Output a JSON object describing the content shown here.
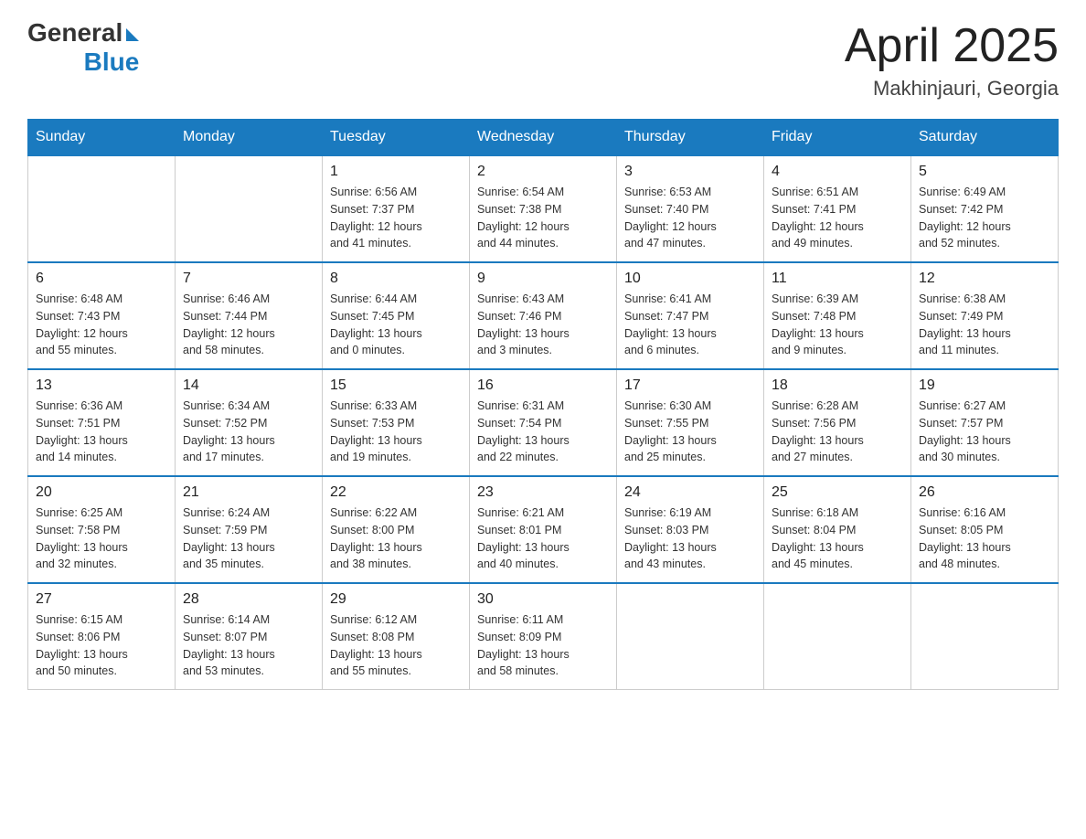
{
  "header": {
    "logo_general": "General",
    "logo_blue": "Blue",
    "month_title": "April 2025",
    "location": "Makhinjauri, Georgia"
  },
  "days_of_week": [
    "Sunday",
    "Monday",
    "Tuesday",
    "Wednesday",
    "Thursday",
    "Friday",
    "Saturday"
  ],
  "weeks": [
    [
      {
        "day": "",
        "info": ""
      },
      {
        "day": "",
        "info": ""
      },
      {
        "day": "1",
        "info": "Sunrise: 6:56 AM\nSunset: 7:37 PM\nDaylight: 12 hours\nand 41 minutes."
      },
      {
        "day": "2",
        "info": "Sunrise: 6:54 AM\nSunset: 7:38 PM\nDaylight: 12 hours\nand 44 minutes."
      },
      {
        "day": "3",
        "info": "Sunrise: 6:53 AM\nSunset: 7:40 PM\nDaylight: 12 hours\nand 47 minutes."
      },
      {
        "day": "4",
        "info": "Sunrise: 6:51 AM\nSunset: 7:41 PM\nDaylight: 12 hours\nand 49 minutes."
      },
      {
        "day": "5",
        "info": "Sunrise: 6:49 AM\nSunset: 7:42 PM\nDaylight: 12 hours\nand 52 minutes."
      }
    ],
    [
      {
        "day": "6",
        "info": "Sunrise: 6:48 AM\nSunset: 7:43 PM\nDaylight: 12 hours\nand 55 minutes."
      },
      {
        "day": "7",
        "info": "Sunrise: 6:46 AM\nSunset: 7:44 PM\nDaylight: 12 hours\nand 58 minutes."
      },
      {
        "day": "8",
        "info": "Sunrise: 6:44 AM\nSunset: 7:45 PM\nDaylight: 13 hours\nand 0 minutes."
      },
      {
        "day": "9",
        "info": "Sunrise: 6:43 AM\nSunset: 7:46 PM\nDaylight: 13 hours\nand 3 minutes."
      },
      {
        "day": "10",
        "info": "Sunrise: 6:41 AM\nSunset: 7:47 PM\nDaylight: 13 hours\nand 6 minutes."
      },
      {
        "day": "11",
        "info": "Sunrise: 6:39 AM\nSunset: 7:48 PM\nDaylight: 13 hours\nand 9 minutes."
      },
      {
        "day": "12",
        "info": "Sunrise: 6:38 AM\nSunset: 7:49 PM\nDaylight: 13 hours\nand 11 minutes."
      }
    ],
    [
      {
        "day": "13",
        "info": "Sunrise: 6:36 AM\nSunset: 7:51 PM\nDaylight: 13 hours\nand 14 minutes."
      },
      {
        "day": "14",
        "info": "Sunrise: 6:34 AM\nSunset: 7:52 PM\nDaylight: 13 hours\nand 17 minutes."
      },
      {
        "day": "15",
        "info": "Sunrise: 6:33 AM\nSunset: 7:53 PM\nDaylight: 13 hours\nand 19 minutes."
      },
      {
        "day": "16",
        "info": "Sunrise: 6:31 AM\nSunset: 7:54 PM\nDaylight: 13 hours\nand 22 minutes."
      },
      {
        "day": "17",
        "info": "Sunrise: 6:30 AM\nSunset: 7:55 PM\nDaylight: 13 hours\nand 25 minutes."
      },
      {
        "day": "18",
        "info": "Sunrise: 6:28 AM\nSunset: 7:56 PM\nDaylight: 13 hours\nand 27 minutes."
      },
      {
        "day": "19",
        "info": "Sunrise: 6:27 AM\nSunset: 7:57 PM\nDaylight: 13 hours\nand 30 minutes."
      }
    ],
    [
      {
        "day": "20",
        "info": "Sunrise: 6:25 AM\nSunset: 7:58 PM\nDaylight: 13 hours\nand 32 minutes."
      },
      {
        "day": "21",
        "info": "Sunrise: 6:24 AM\nSunset: 7:59 PM\nDaylight: 13 hours\nand 35 minutes."
      },
      {
        "day": "22",
        "info": "Sunrise: 6:22 AM\nSunset: 8:00 PM\nDaylight: 13 hours\nand 38 minutes."
      },
      {
        "day": "23",
        "info": "Sunrise: 6:21 AM\nSunset: 8:01 PM\nDaylight: 13 hours\nand 40 minutes."
      },
      {
        "day": "24",
        "info": "Sunrise: 6:19 AM\nSunset: 8:03 PM\nDaylight: 13 hours\nand 43 minutes."
      },
      {
        "day": "25",
        "info": "Sunrise: 6:18 AM\nSunset: 8:04 PM\nDaylight: 13 hours\nand 45 minutes."
      },
      {
        "day": "26",
        "info": "Sunrise: 6:16 AM\nSunset: 8:05 PM\nDaylight: 13 hours\nand 48 minutes."
      }
    ],
    [
      {
        "day": "27",
        "info": "Sunrise: 6:15 AM\nSunset: 8:06 PM\nDaylight: 13 hours\nand 50 minutes."
      },
      {
        "day": "28",
        "info": "Sunrise: 6:14 AM\nSunset: 8:07 PM\nDaylight: 13 hours\nand 53 minutes."
      },
      {
        "day": "29",
        "info": "Sunrise: 6:12 AM\nSunset: 8:08 PM\nDaylight: 13 hours\nand 55 minutes."
      },
      {
        "day": "30",
        "info": "Sunrise: 6:11 AM\nSunset: 8:09 PM\nDaylight: 13 hours\nand 58 minutes."
      },
      {
        "day": "",
        "info": ""
      },
      {
        "day": "",
        "info": ""
      },
      {
        "day": "",
        "info": ""
      }
    ]
  ]
}
